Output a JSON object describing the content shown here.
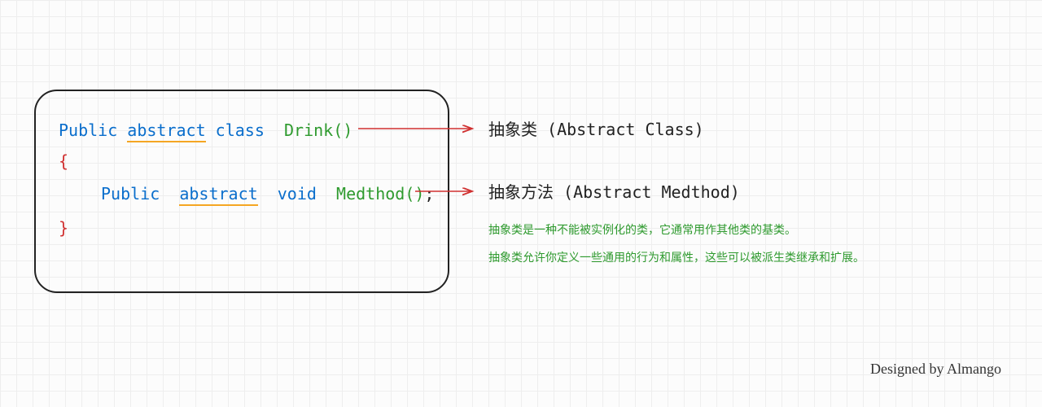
{
  "code": {
    "line1_public": "Public",
    "line1_abstract": "abstract",
    "line1_class": "class",
    "line1_name": "Drink()",
    "brace_open": "{",
    "line3_public": "Public",
    "line3_abstract": "abstract",
    "line3_void": "void",
    "line3_name": "Medthod()",
    "line3_semicolon": ";",
    "brace_close": "}"
  },
  "labels": {
    "abstract_class": "抽象类 (Abstract Class)",
    "abstract_method": "抽象方法 (Abstract Medthod)"
  },
  "explain": {
    "e1": "抽象类是一种不能被实例化的类，它通常用作其他类的基类。",
    "e2": "抽象类允许你定义一些通用的行为和属性，这些可以被派生类继承和扩展。"
  },
  "signature": "Designed by Almango"
}
